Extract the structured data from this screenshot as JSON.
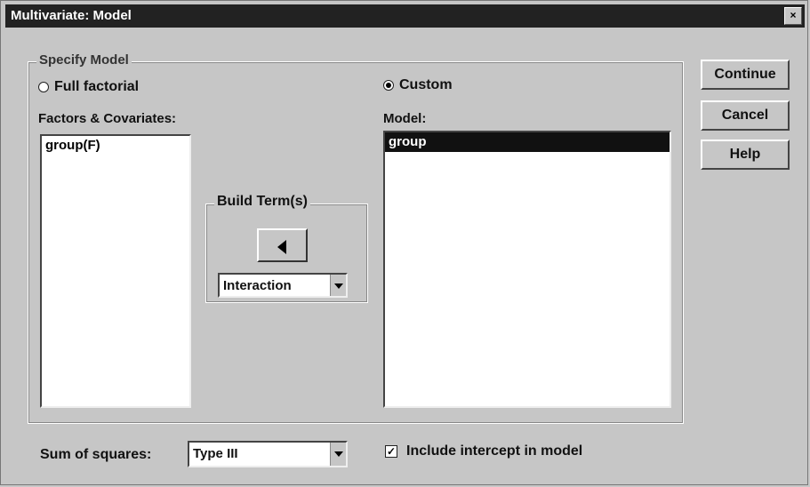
{
  "window": {
    "title": "Multivariate: Model",
    "close_glyph": "×"
  },
  "specify_model": {
    "legend": "Specify Model",
    "full_factorial_label": "Full factorial",
    "custom_label": "Custom",
    "selected": "custom"
  },
  "factors": {
    "label": "Factors & Covariates:",
    "items": [
      "group(F)"
    ]
  },
  "model": {
    "label": "Model:",
    "items": [
      "group"
    ],
    "selected_index": 0
  },
  "build_terms": {
    "legend": "Build Term(s)",
    "arrow_icon": "left-arrow-icon",
    "type_value": "Interaction"
  },
  "buttons": {
    "continue_label": "Continue",
    "cancel_label": "Cancel",
    "help_label": "Help"
  },
  "footer": {
    "sum_of_squares_label": "Sum of squares:",
    "sum_of_squares_value": "Type III",
    "intercept_label": "Include intercept in model",
    "intercept_checked": true
  }
}
